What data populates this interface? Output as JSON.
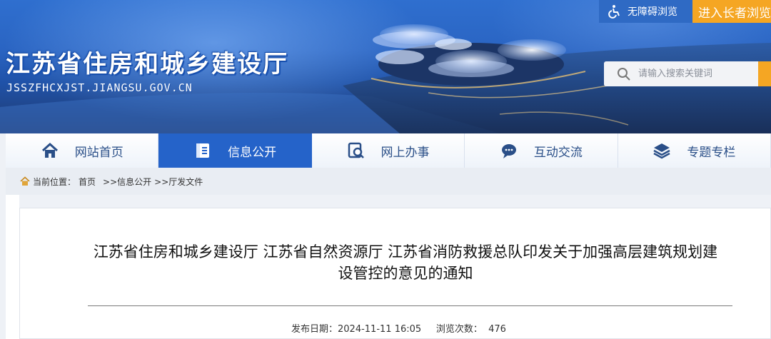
{
  "header": {
    "site_title": "江苏省住房和城乡建设厅",
    "site_url": "JSSZFHCXJST.JIANGSU.GOV.CN",
    "accessibility_label": "无障碍浏览",
    "elder_mode_label": "进入长者浏览",
    "search": {
      "placeholder": "请输入搜索关键词"
    }
  },
  "nav": {
    "items": [
      {
        "label": "网站首页",
        "icon": "home-icon"
      },
      {
        "label": "信息公开",
        "icon": "document-list-icon",
        "active": true
      },
      {
        "label": "网上办事",
        "icon": "online-service-icon"
      },
      {
        "label": "互动交流",
        "icon": "chat-bubble-icon"
      },
      {
        "label": "专题专栏",
        "icon": "layers-icon"
      }
    ]
  },
  "breadcrumb": {
    "prefix": "当前位置：",
    "items": [
      "首页",
      ">>信息公开",
      ">>厅发文件"
    ]
  },
  "article": {
    "title": "江苏省住房和城乡建设厅 江苏省自然资源厅 江苏省消防救援总队印发关于加强高层建筑规划建设管控的意见的通知",
    "publish_label": "发布日期：",
    "publish_date": "2024-11-11 16:05",
    "views_label": "浏览次数：",
    "views": "476"
  },
  "colors": {
    "nav_active": "#2563c9",
    "elder_button": "#f5a623",
    "accessibility_button": "#2f6ac4",
    "nav_text": "#2a4f88"
  }
}
